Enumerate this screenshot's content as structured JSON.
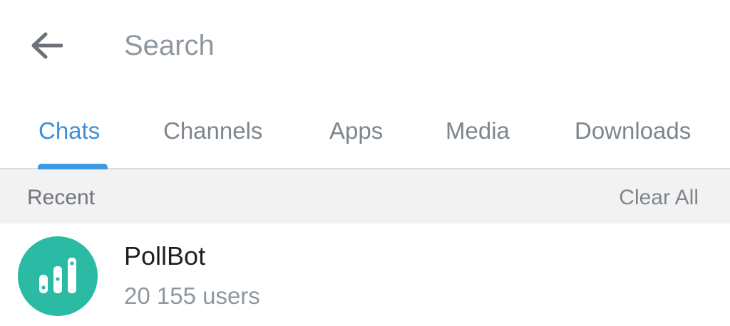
{
  "search": {
    "placeholder": "Search",
    "back_icon": "arrow-left-icon"
  },
  "tabs": [
    {
      "label": "Chats",
      "active": true
    },
    {
      "label": "Channels",
      "active": false
    },
    {
      "label": "Apps",
      "active": false
    },
    {
      "label": "Media",
      "active": false
    },
    {
      "label": "Downloads",
      "active": false
    }
  ],
  "recent": {
    "title": "Recent",
    "clear_label": "Clear All",
    "items": [
      {
        "name": "PollBot",
        "subtitle": "20 155 users",
        "avatar_icon": "poll-chart-icon",
        "avatar_color": "#2bbba5"
      }
    ]
  },
  "colors": {
    "accent": "#3e8fd3",
    "tab_indicator": "#3e9ae0",
    "muted_text": "#7e868d",
    "section_bg": "#f2f2f2"
  }
}
